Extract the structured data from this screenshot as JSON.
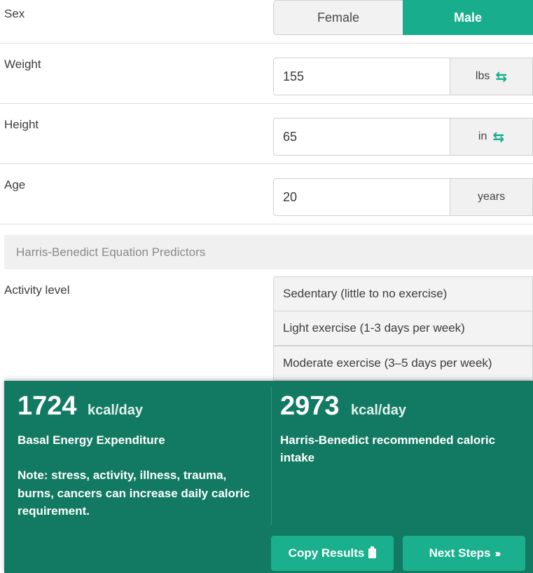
{
  "sex": {
    "label": "Sex",
    "options": [
      "Female",
      "Male"
    ],
    "selected": "Male"
  },
  "weight": {
    "label": "Weight",
    "value": "155",
    "unit": "lbs"
  },
  "height": {
    "label": "Height",
    "value": "65",
    "unit": "in"
  },
  "age": {
    "label": "Age",
    "value": "20",
    "unit": "years"
  },
  "section": {
    "title": "Harris-Benedict Equation Predictors"
  },
  "activity": {
    "label": "Activity level",
    "options": [
      "Sedentary (little to no exercise)",
      "Light exercise (1-3 days per week)",
      "Moderate exercise (3–5 days per week)"
    ]
  },
  "results": {
    "bee": {
      "value": "1724",
      "unit": "kcal/day",
      "title": "Basal Energy Expenditure"
    },
    "note": "Note: stress, activity, illness, trauma, burns, cancers can increase daily caloric requirement.",
    "recommended": {
      "value": "2973",
      "unit": "kcal/day",
      "title": "Harris-Benedict recommended caloric intake"
    },
    "copy_label": "Copy Results",
    "next_label": "Next Steps"
  },
  "colors": {
    "accent": "#18ad8c",
    "panel": "#127a63"
  },
  "icons": {
    "swap": "swap-arrows-icon",
    "copy": "clipboard-icon",
    "next": "chevrons-right-icon"
  }
}
